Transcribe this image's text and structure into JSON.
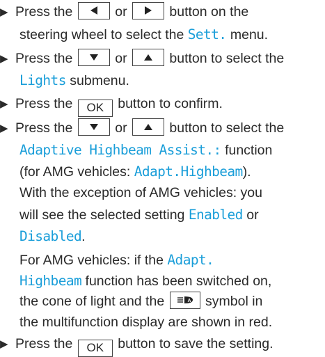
{
  "steps": {
    "s1": {
      "pre": "Press the",
      "or": "or",
      "post": "button on the",
      "l2": "steering wheel to select the",
      "menu": "Sett.",
      "l2end": "menu."
    },
    "s2": {
      "pre": "Press the",
      "or": "or",
      "post": "button to select the",
      "sub": "Lights",
      "subend": "submenu."
    },
    "s3": {
      "pre": "Press the",
      "btn": "OK",
      "post": "button to confirm."
    },
    "s4": {
      "pre": "Press the",
      "or": "or",
      "post": "button to select the",
      "func": "Adaptive Highbeam Assist.:",
      "funcend": "function",
      "amg_pre": "(for AMG vehicles:",
      "amg_val": "Adapt.Highbeam",
      "amg_end": ").",
      "l4": "With the exception of AMG vehicles: you",
      "l5": "will see the selected setting",
      "enabled": "Enabled",
      "or2": "or",
      "disabled": "Disabled",
      "dot": ".",
      "p2_l1": "For AMG vehicles: if the",
      "p2_val1": "Adapt.",
      "p2_val2": "Highbeam",
      "p2_l2end": "function has been switched on,",
      "p2_l3a": "the cone of light and the",
      "p2_l3b": "symbol in",
      "p2_l4": "the multifunction display are shown in red."
    },
    "s5": {
      "pre": "Press the",
      "btn": "OK",
      "post": "button to save the setting."
    }
  },
  "icons": [
    "left-arrow-button-icon",
    "right-arrow-button-icon",
    "down-arrow-button-icon",
    "up-arrow-button-icon",
    "highbeam-assist-symbol-icon",
    "bullet-triangle-icon"
  ]
}
